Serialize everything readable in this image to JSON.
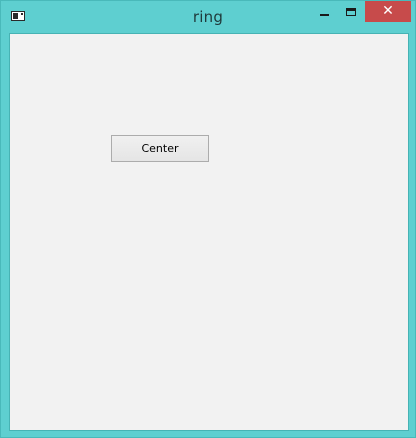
{
  "window": {
    "title": "ring",
    "close_symbol": "✕",
    "accent_color": "#5ecfd0",
    "close_color": "#c74b4b"
  },
  "titlebar_icons": [
    "app-icon",
    "minimize-icon",
    "maximize-icon",
    "close-icon"
  ],
  "content": {
    "center_button_label": "Center"
  }
}
